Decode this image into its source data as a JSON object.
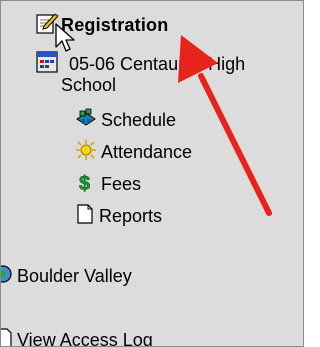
{
  "tree": {
    "registration": {
      "label": "Registration",
      "icon": "edit-icon"
    },
    "school": {
      "label_line1": "05-06 Centaurus High",
      "label_line2": "School",
      "icon": "calendar-icon"
    },
    "schedule": {
      "label": "Schedule",
      "icon": "schedule-icon"
    },
    "attendance": {
      "label": "Attendance",
      "icon": "attendance-icon"
    },
    "fees": {
      "label": "Fees",
      "icon": "dollar-icon"
    },
    "reports": {
      "label": "Reports",
      "icon": "document-icon"
    },
    "district": {
      "label": "Boulder Valley",
      "icon": "globe-icon"
    },
    "access_log": {
      "label": "View Access Log",
      "icon": "document-icon"
    }
  },
  "annotation": {
    "arrow_color": "#e8231c",
    "cursor": "arrow-cursor"
  }
}
